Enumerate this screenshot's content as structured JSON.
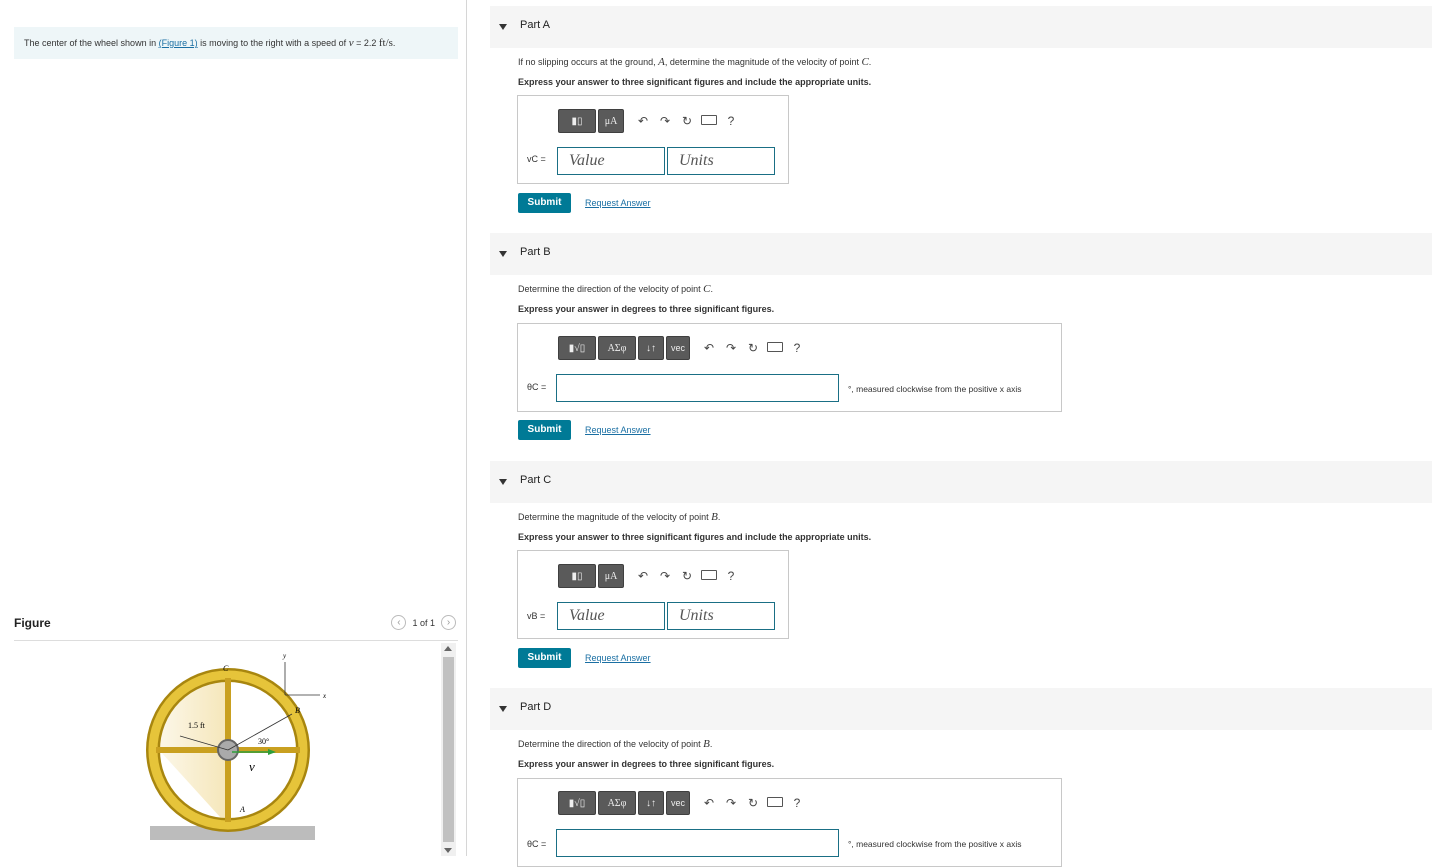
{
  "problem": {
    "text_before": "The center of the wheel shown in ",
    "figure_link": "(Figure 1)",
    "text_after": " is moving to the right with a speed of ",
    "var": "v",
    "eq": " = 2.2 ",
    "unit": "ft/s",
    "period": "."
  },
  "figure_panel": {
    "title": "Figure",
    "pager": "1 of 1",
    "labels": {
      "c": "C",
      "b": "B",
      "a": "A",
      "y": "y",
      "x": "x",
      "radius": "1.5 ft",
      "angle": "30°",
      "v": "v"
    }
  },
  "parts": [
    {
      "title": "Part A",
      "question_before": "If no slipping occurs at the ground, ",
      "question_var1": "A",
      "question_mid": ", determine the magnitude of the velocity of point ",
      "question_var2": "C",
      "question_after": ".",
      "instruction": "Express your answer to three significant figures and include the appropriate units.",
      "var_label": "vC =",
      "value_placeholder": "Value",
      "units_placeholder": "Units",
      "tool_mu": "μA",
      "submit": "Submit",
      "request": "Request Answer"
    },
    {
      "title": "Part B",
      "question_before": "Determine the direction of the velocity of point ",
      "question_var": "C",
      "question_after": ".",
      "instruction": "Express your answer in degrees to three significant figures.",
      "var_label": "θC =",
      "after_field": "°, measured clockwise from the positive x axis",
      "tool_greek": "ΑΣφ",
      "tool_vec": "vec",
      "submit": "Submit",
      "request": "Request Answer"
    },
    {
      "title": "Part C",
      "question_before": "Determine the magnitude of the velocity of point ",
      "question_var": "B",
      "question_after": ".",
      "instruction": "Express your answer to three significant figures and include the appropriate units.",
      "var_label": "vB =",
      "value_placeholder": "Value",
      "units_placeholder": "Units",
      "tool_mu": "μA",
      "submit": "Submit",
      "request": "Request Answer"
    },
    {
      "title": "Part D",
      "question_before": "Determine the direction of the velocity of point ",
      "question_var": "B",
      "question_after": ".",
      "instruction": "Express your answer in degrees to three significant figures.",
      "var_label": "θC =",
      "after_field": "°, measured clockwise from the positive x axis",
      "tool_greek": "ΑΣφ",
      "tool_vec": "vec"
    }
  ],
  "toolbar_help": "?",
  "colors": {
    "accent": "#007a96",
    "link": "#1a6fa3",
    "wheel": "#d4aa1e"
  }
}
